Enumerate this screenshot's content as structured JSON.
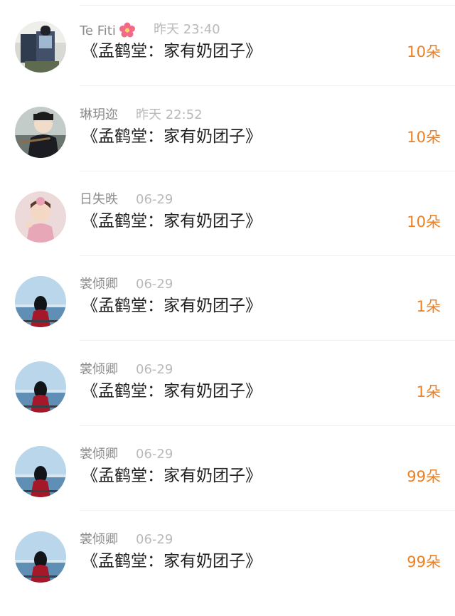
{
  "colors": {
    "accent": "#ef7f1f",
    "name": "#8c8c8c",
    "time": "#b9b9b9"
  },
  "rows": [
    {
      "name": "Te Fiti",
      "name_icon": "flower-icon",
      "time": "昨天 23:40",
      "book": "《孟鹤堂：家有奶团子》",
      "gift": "10朵",
      "avatar": "avatar-person-with-luggage"
    },
    {
      "name": "琳玥迩",
      "time": "昨天 22:52",
      "book": "《孟鹤堂：家有奶团子》",
      "gift": "10朵",
      "avatar": "avatar-man-playing-flute"
    },
    {
      "name": "日失昳",
      "time": "06-29",
      "book": "《孟鹤堂：家有奶团子》",
      "gift": "10朵",
      "avatar": "avatar-child-pink"
    },
    {
      "name": "裳倾卿",
      "time": "06-29",
      "book": "《孟鹤堂：家有奶团子》",
      "gift": "1朵",
      "avatar": "avatar-girl-by-sea"
    },
    {
      "name": "裳倾卿",
      "time": "06-29",
      "book": "《孟鹤堂：家有奶团子》",
      "gift": "1朵",
      "avatar": "avatar-girl-by-sea"
    },
    {
      "name": "裳倾卿",
      "time": "06-29",
      "book": "《孟鹤堂：家有奶团子》",
      "gift": "99朵",
      "avatar": "avatar-girl-by-sea"
    },
    {
      "name": "裳倾卿",
      "time": "06-29",
      "book": "《孟鹤堂：家有奶团子》",
      "gift": "99朵",
      "avatar": "avatar-girl-by-sea"
    }
  ]
}
